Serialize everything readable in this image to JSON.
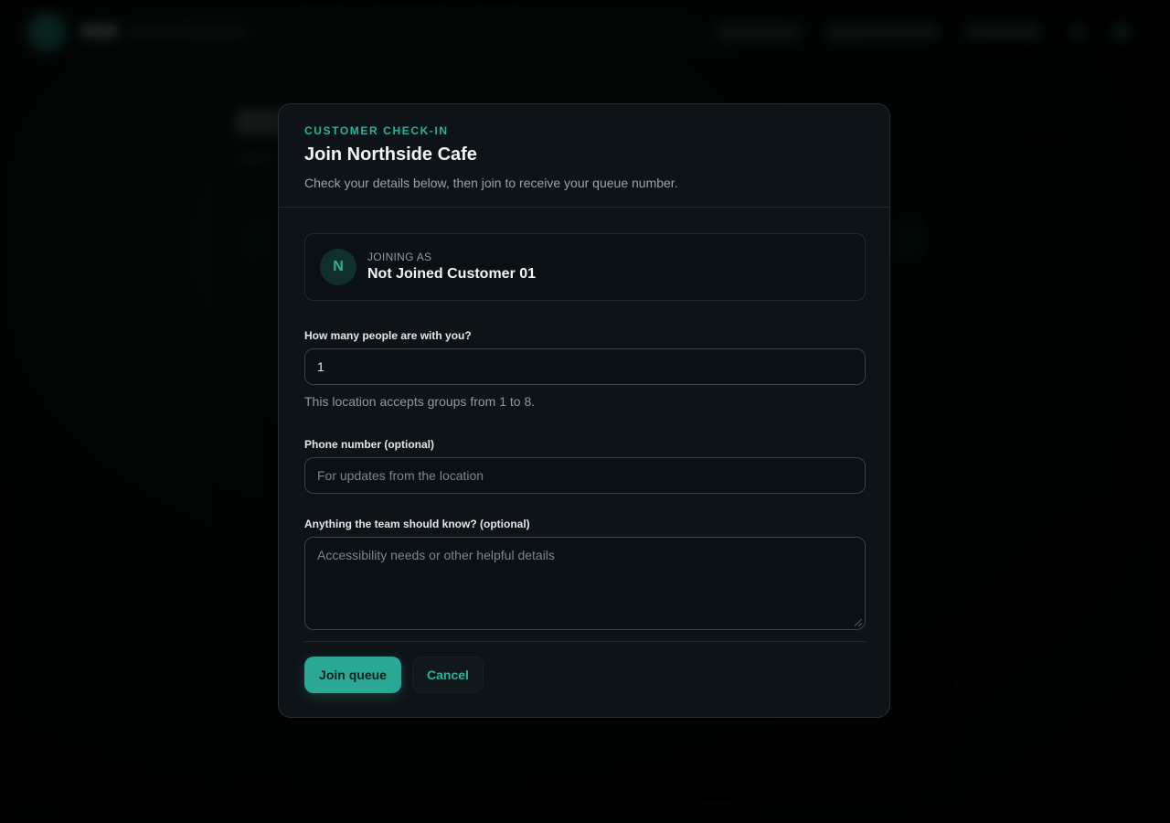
{
  "modal": {
    "eyebrow": "CUSTOMER CHECK-IN",
    "title": "Join Northside Cafe",
    "description": "Check your details below, then join to receive your queue number."
  },
  "identity": {
    "initial": "N",
    "label": "JOINING AS",
    "name": "Not Joined Customer 01"
  },
  "form": {
    "party_size": {
      "label": "How many people are with you?",
      "value": "1",
      "hint": "This location accepts groups from 1 to 8."
    },
    "phone": {
      "label": "Phone number (optional)",
      "value": "",
      "placeholder": "For updates from the location"
    },
    "notes": {
      "label": "Anything the team should know? (optional)",
      "value": "",
      "placeholder": "Accessibility needs or other helpful details"
    }
  },
  "actions": {
    "primary_label": "Join queue",
    "secondary_label": "Cancel"
  },
  "colors": {
    "accent": "#2bb39a",
    "modal_bg": "#0e1317",
    "page_bg": "#000000"
  }
}
